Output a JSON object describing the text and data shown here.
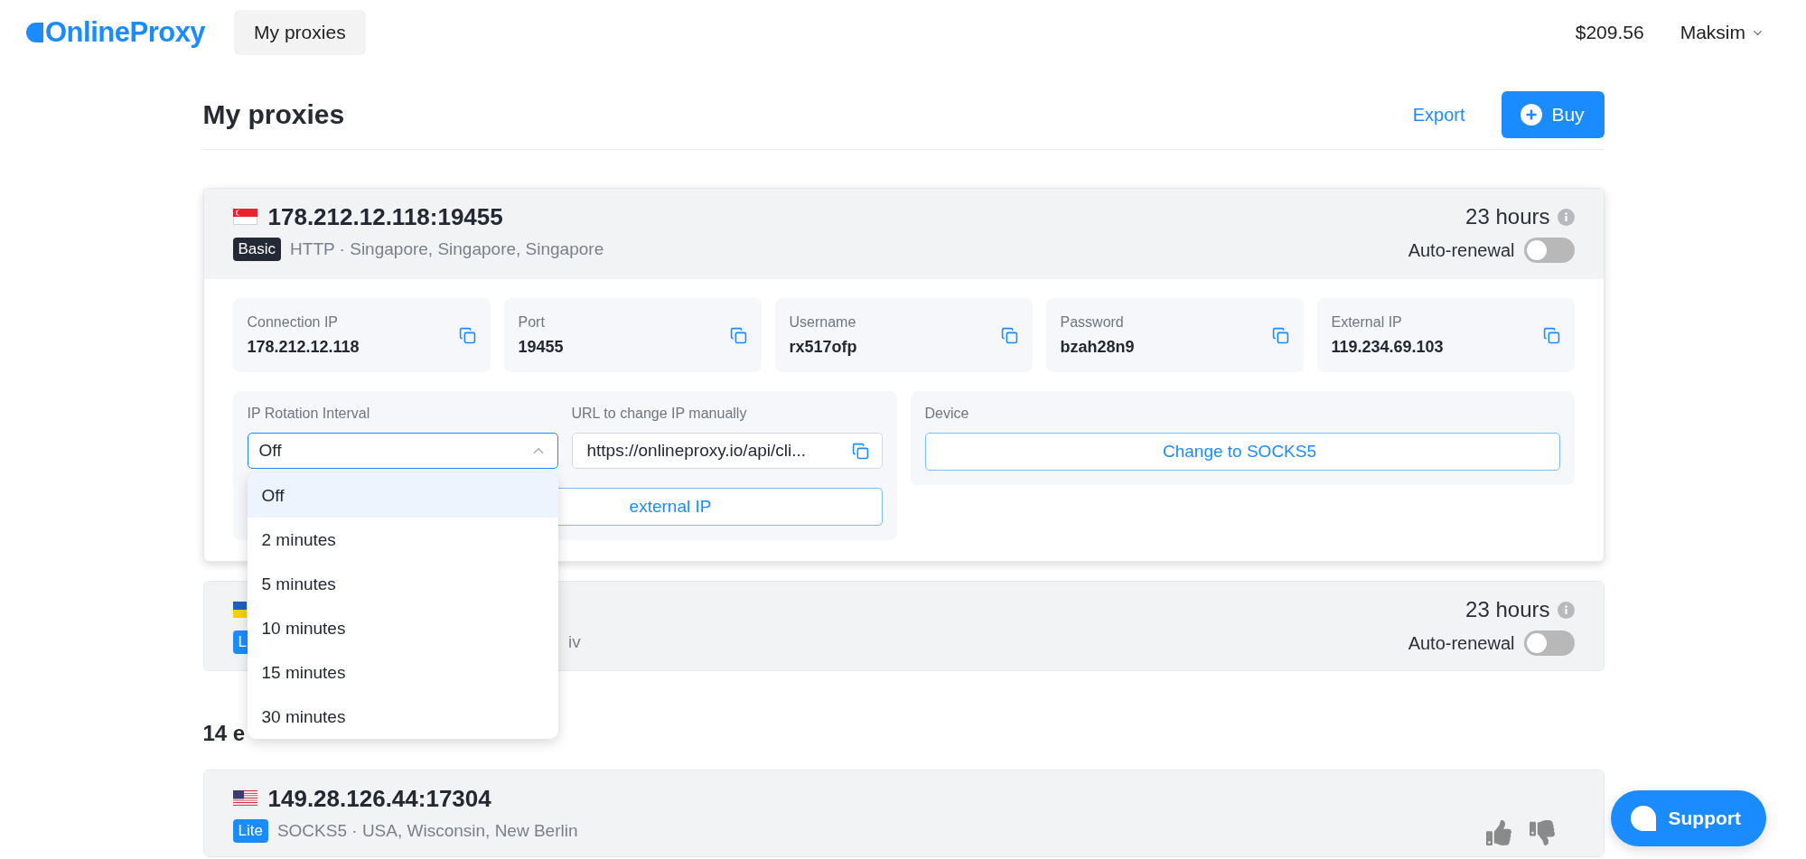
{
  "header": {
    "logo": "OnlineProxy",
    "nav": [
      {
        "label": "My proxies",
        "selected": true
      }
    ],
    "balance": "$209.56",
    "user": "Maksim"
  },
  "page": {
    "title": "My proxies",
    "export": "Export",
    "buy": "Buy"
  },
  "active": [
    {
      "flag": {
        "kind": "sg"
      },
      "address": "178.212.12.118:19455",
      "plan": {
        "label": "Basic",
        "color": "#232a36"
      },
      "location": "HTTP · Singapore, Singapore, Singapore",
      "time": "23 hours",
      "renewal_label": "Auto-renewal",
      "auto_renewal": false,
      "fields": [
        {
          "label": "Connection IP",
          "value": "178.212.12.118"
        },
        {
          "label": "Port",
          "value": "19455"
        },
        {
          "label": "Username",
          "value": "rx517ofp"
        },
        {
          "label": "Password",
          "value": "bzah28n9"
        },
        {
          "label": "External IP",
          "value": "119.234.69.103"
        }
      ],
      "rotation": {
        "label": "IP Rotation Interval",
        "value": "Off",
        "expanded": true,
        "options": [
          {
            "label": "Off",
            "selected": true
          },
          {
            "label": "2 minutes",
            "selected": false
          },
          {
            "label": "5 minutes",
            "selected": false
          },
          {
            "label": "10 minutes",
            "selected": false
          },
          {
            "label": "15 minutes",
            "selected": false
          },
          {
            "label": "30 minutes",
            "selected": false
          }
        ]
      },
      "url": {
        "label": "URL to change IP manually",
        "value": "https://onlineproxy.io/api/cli..."
      },
      "change_button": "external IP",
      "device": {
        "label": "Device",
        "button": "Change to SOCKS5"
      }
    },
    {
      "flag": {
        "kind": "ua"
      },
      "plan": {
        "label": "L",
        "color": "#1b8cff"
      },
      "location": "iv",
      "time": "23 hours",
      "renewal_label": "Auto-renewal",
      "auto_renewal": false
    }
  ],
  "section_title": "14 e",
  "expired": [
    {
      "flag": {
        "kind": "us"
      },
      "address": "149.28.126.44:17304",
      "plan": {
        "label": "Lite",
        "color": "#1b8cff"
      },
      "location": "SOCKS5 · USA, Wisconsin, New Berlin"
    }
  ],
  "support": "Support"
}
